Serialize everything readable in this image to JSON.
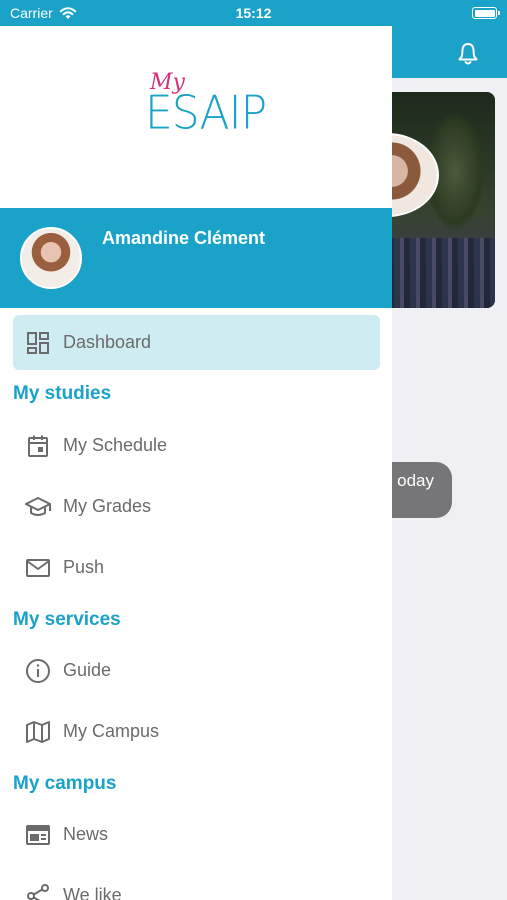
{
  "status_bar": {
    "carrier": "Carrier",
    "time": "15:12"
  },
  "background": {
    "pill_text": "oday"
  },
  "drawer": {
    "logo": {
      "my": "My",
      "esaip": "ESAIP"
    },
    "profile": {
      "name": "Amandine Clément"
    },
    "dashboard": {
      "label": "Dashboard",
      "icon": "dashboard-icon"
    },
    "sections": {
      "studies": {
        "title": "My studies",
        "items": [
          {
            "label": "My Schedule",
            "icon": "calendar-icon"
          },
          {
            "label": "My Grades",
            "icon": "graduation-cap-icon"
          },
          {
            "label": "Push",
            "icon": "mail-icon"
          }
        ]
      },
      "services": {
        "title": "My services",
        "items": [
          {
            "label": "Guide",
            "icon": "info-icon"
          },
          {
            "label": "My Campus",
            "icon": "map-icon"
          }
        ]
      },
      "campus": {
        "title": "My campus",
        "items": [
          {
            "label": "News",
            "icon": "news-icon"
          },
          {
            "label": "We like",
            "icon": "share-icon"
          }
        ]
      }
    }
  },
  "colors": {
    "primary": "#1aa2c8",
    "accent": "#d6317c",
    "active_bg": "#cfecf3",
    "text_gray": "#6b6b6b"
  }
}
